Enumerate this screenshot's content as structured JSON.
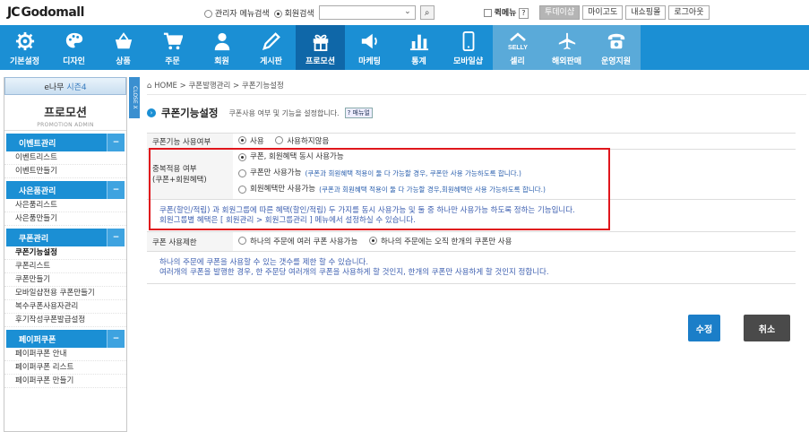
{
  "logo": {
    "mark": "JC",
    "name": "Godomall"
  },
  "header": {
    "search_options": [
      {
        "label": "관리자 메뉴검색",
        "selected": false
      },
      {
        "label": "회원검색",
        "selected": true
      }
    ],
    "quick_menu_label": "퀵메뉴",
    "help_label": "?",
    "buttons": [
      {
        "label": "투데이샵",
        "dark": true
      },
      {
        "label": "마이고도",
        "dark": false
      },
      {
        "label": "내쇼핑몰",
        "dark": false
      },
      {
        "label": "로그아웃",
        "dark": false
      }
    ]
  },
  "nav": [
    {
      "label": "기본설정",
      "icon": "gear-icon"
    },
    {
      "label": "디자인",
      "icon": "palette-icon"
    },
    {
      "label": "상품",
      "icon": "basket-icon"
    },
    {
      "label": "주문",
      "icon": "cart-icon"
    },
    {
      "label": "회원",
      "icon": "person-icon"
    },
    {
      "label": "게시판",
      "icon": "pencil-icon"
    },
    {
      "label": "프로모션",
      "icon": "gift-icon",
      "active": true
    },
    {
      "label": "마케팅",
      "icon": "megaphone-icon"
    },
    {
      "label": "통계",
      "icon": "bar-chart-icon"
    },
    {
      "label": "모바일샵",
      "icon": "mobile-icon"
    },
    {
      "label": "셀리",
      "icon": "selly-icon",
      "alt": true,
      "badge": "SELLY"
    },
    {
      "label": "해외판매",
      "icon": "airplane-icon",
      "alt": true
    },
    {
      "label": "운영지원",
      "icon": "phone-icon",
      "alt": true
    }
  ],
  "sidebar": {
    "tab_prefix": "e나무",
    "tab_highlight": "시즌4",
    "title": "프로모션",
    "subtitle": "PROMOTION ADMIN",
    "close_label": "CLOSE X",
    "groups": [
      {
        "label": "이벤트관리",
        "items": [
          "이벤트리스트",
          "이벤트만들기"
        ]
      },
      {
        "label": "사은품관리",
        "items": [
          "사은품리스트",
          "사은품만들기"
        ]
      },
      {
        "label": "쿠폰관리",
        "items": [
          "쿠폰기능설정",
          "쿠폰리스트",
          "쿠폰만들기",
          "모바일샵전용 쿠폰만들기",
          "복수쿠폰사용자관리",
          "후기작성쿠폰발급설정"
        ]
      },
      {
        "label": "페이퍼쿠폰",
        "items": [
          "페이퍼쿠폰 안내",
          "페이퍼쿠폰 리스트",
          "페이퍼쿠폰 만들기"
        ]
      }
    ],
    "current_item": "쿠폰기능설정"
  },
  "breadcrumb": [
    "HOME",
    "쿠폰발행관리",
    "쿠폰기능설정"
  ],
  "page": {
    "title": "쿠폰기능설정",
    "description": "쿠폰사용 여부 및 기능을 설정합니다.",
    "help_label": "? 매뉴얼"
  },
  "form": {
    "use": {
      "label": "쿠폰기능 사용여부",
      "options": [
        {
          "label": "사용",
          "selected": true
        },
        {
          "label": "사용하지않음",
          "selected": false
        }
      ]
    },
    "dup": {
      "label_line1": "중복적용 여부",
      "label_line2": "(쿠폰+회원혜택)",
      "options": [
        {
          "label": "쿠폰, 회원혜택 동시 사용가능",
          "note": "",
          "selected": true
        },
        {
          "label": "쿠폰만 사용가능",
          "note": "(쿠폰과 회원혜택 적용이 둘 다 가능할 경우, 쿠폰만 사용 가능하도록 합니다.)",
          "selected": false
        },
        {
          "label": "회원혜택만 사용가능",
          "note": "(쿠폰과 회원혜택 적용이 둘 다 가능할 경우,회원혜택만 사용 가능하도록 합니다.)",
          "selected": false
        }
      ],
      "desc_line1": "쿠폰(할인/적립) 과 회원그룹에 따른 혜택(할인/적립) 두 가지를 동시 사용가능 및 둘 중 하나만 사용가능 하도록 정하는 기능입니다.",
      "desc_line2": "회원그룹별 혜택은 [ 회원관리 > 회원그룹관리 ] 메뉴에서 설정하실 수 있습니다."
    },
    "limit": {
      "label": "쿠폰 사용제한",
      "options": [
        {
          "label": "하나의 주문에 여러 쿠폰 사용가능",
          "selected": false
        },
        {
          "label": "하나의 주문에는 오직 한개의 쿠폰만 사용",
          "selected": true
        }
      ],
      "desc_line1": "하나의 주문에 쿠폰을 사용할 수 있는 갯수를 제한 할 수 있습니다.",
      "desc_line2": "여러개의 쿠폰을 발행한 경우, 한 주문당 여러개의 쿠폰을 사용하게 할 것인지, 한개의 쿠폰만 사용하게 할 것인지 정합니다."
    }
  },
  "actions": {
    "save": "수정",
    "cancel": "취소"
  },
  "colors": {
    "nav": "#1b8fd4",
    "active_nav": "#0f67a8",
    "highlight": "#e0161c"
  }
}
